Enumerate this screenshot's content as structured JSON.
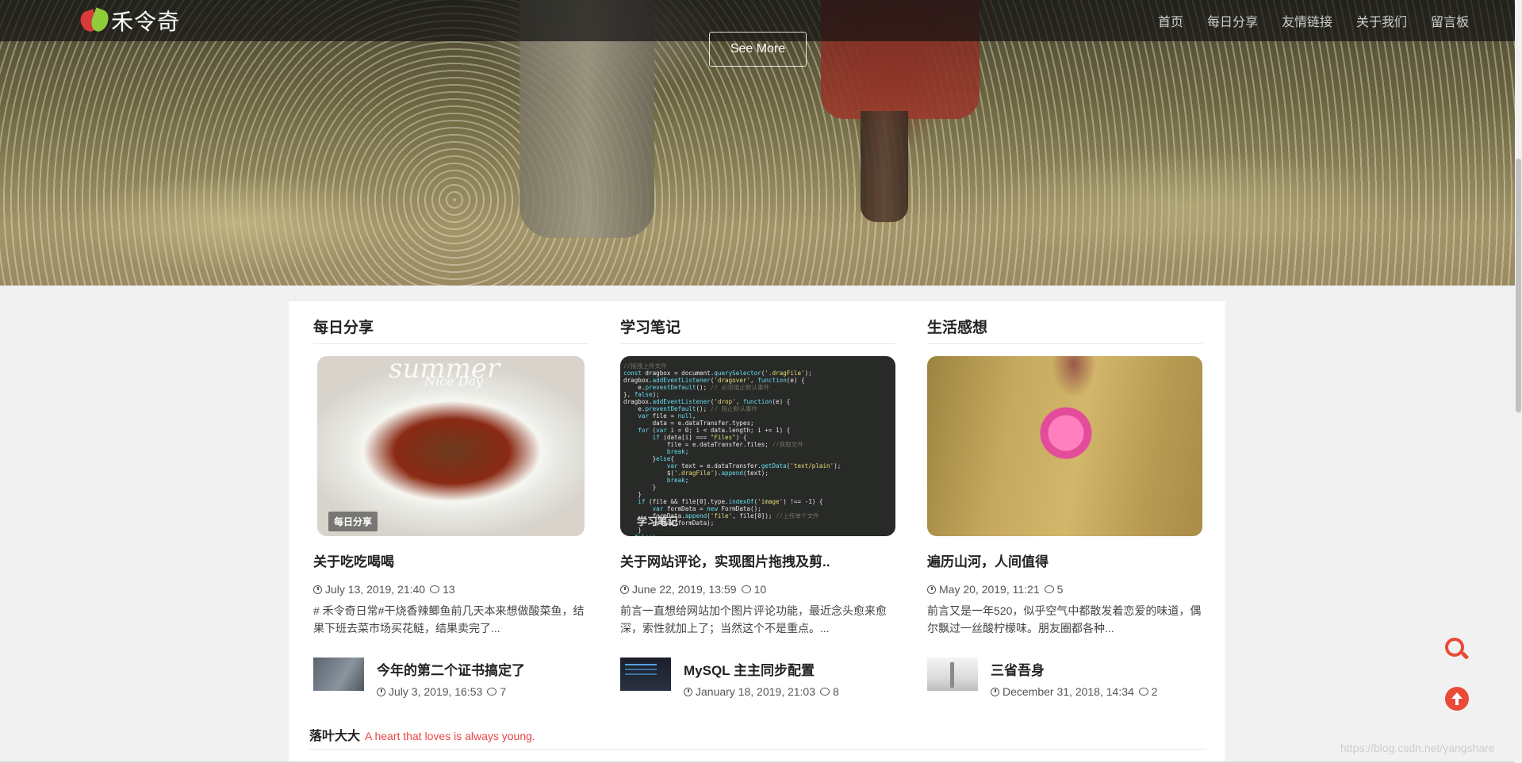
{
  "nav": {
    "logo_text": "禾令奇",
    "items": [
      {
        "label": "首页"
      },
      {
        "label": "每日分享"
      },
      {
        "label": "友情链接"
      },
      {
        "label": "关于我们"
      },
      {
        "label": "留言板"
      }
    ]
  },
  "hero": {
    "see_more": "See More"
  },
  "columns": [
    {
      "title": "每日分享",
      "image_tag": "每日分享",
      "image_text_1": "summer",
      "image_text_2": "Nice Day",
      "post_title": "关于吃吃喝喝",
      "date": "July 13, 2019, 21:40",
      "comments": "13",
      "excerpt": "# 禾令奇日常#干烧香辣鲫鱼前几天本来想做酸菜鱼，结果下班去菜市场买花鲢，结果卖完了...",
      "mini": {
        "title": "今年的第二个证书搞定了",
        "date": "July 3, 2019, 16:53",
        "comments": "7"
      }
    },
    {
      "title": "学习笔记",
      "image_tag": "学习笔记",
      "post_title": "关于网站评论，实现图片拖拽及剪..",
      "date": "June 22, 2019, 13:59",
      "comments": "10",
      "excerpt": "前言一直想给网站加个图片评论功能，最近念头愈来愈深，索性就加上了；当然这个不是重点。...",
      "mini": {
        "title": "MySQL 主主同步配置",
        "date": "January 18, 2019, 21:03",
        "comments": "8"
      }
    },
    {
      "title": "生活感想",
      "post_title": "遍历山河，人间值得",
      "date": "May 20, 2019, 11:21",
      "comments": "5",
      "excerpt": "前言又是一年520，似乎空气中都散发着恋爱的味道，偶尔飘过一丝酸柠檬味。朋友圈都各种...",
      "mini": {
        "title": "三省吾身",
        "date": "December 31, 2018, 14:34",
        "comments": "2"
      }
    }
  ],
  "footer": {
    "name": "落叶大大",
    "slogan": "A heart that loves is always young."
  },
  "watermark": "https://blog.csdn.net/yangshare",
  "colors": {
    "accent": "#ea4a36",
    "slogan": "#e84545"
  },
  "icons": [
    "search-icon",
    "back-to-top-icon",
    "clock-icon",
    "comment-icon"
  ]
}
